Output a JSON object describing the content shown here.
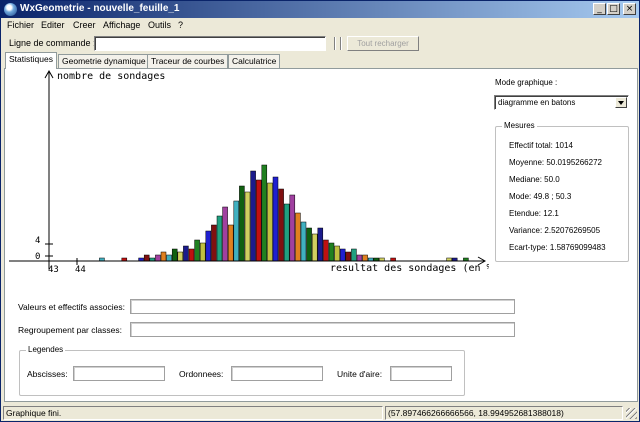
{
  "window": {
    "title": "WxGeometrie - nouvelle_feuille_1",
    "controls": [
      "_",
      "□",
      "×"
    ]
  },
  "menu": [
    "Fichier",
    "Editer",
    "Creer",
    "Affichage",
    "Outils",
    "?"
  ],
  "toolbar": {
    "command_label": "Ligne de commande :",
    "command_value": "",
    "reload_label": "Tout recharger"
  },
  "tabs": [
    "Statistiques",
    "Geometrie dynamique",
    "Traceur de courbes",
    "Calculatrice"
  ],
  "active_tab": 0,
  "chart_data": {
    "type": "bar",
    "ylabel": "nombre de sondages",
    "xlabel": "resultat des sondages (en %)",
    "x_tick_labels": [
      "43",
      "44"
    ],
    "y_tick_labels": [
      "0",
      "4"
    ],
    "x_values": [
      43.0,
      43.2,
      43.4,
      43.6,
      43.8,
      44.0,
      44.2,
      44.4,
      44.6,
      44.8,
      45.0,
      45.2,
      45.4,
      45.6,
      45.8,
      46.0,
      46.2,
      46.4,
      46.6,
      46.8,
      47.0,
      47.2,
      47.4,
      47.6,
      47.8,
      48.0,
      48.2,
      48.4,
      48.6,
      48.8,
      49.0,
      49.2,
      49.4,
      49.6,
      49.8,
      50.0,
      50.2,
      50.4,
      50.6,
      50.8,
      51.0,
      51.2,
      51.4,
      51.6,
      51.8,
      52.0,
      52.2,
      52.4,
      52.6,
      52.8,
      53.0,
      53.2,
      53.4,
      53.6,
      53.8,
      54.0,
      54.2,
      54.4,
      54.6,
      54.8,
      55.0,
      55.2,
      55.4,
      55.6,
      55.8,
      56.0,
      56.2,
      56.4,
      56.6,
      56.8,
      57.0,
      57.2,
      57.4,
      57.6,
      57.8
    ],
    "y_values": [
      0,
      0,
      0,
      0,
      0,
      0,
      0,
      0,
      0,
      1,
      0,
      0,
      0,
      1,
      0,
      0,
      1,
      2,
      1,
      2,
      3,
      2,
      4,
      3,
      5,
      4,
      7,
      6,
      10,
      12,
      15,
      18,
      12,
      20,
      25,
      23,
      30,
      27,
      32,
      26,
      28,
      24,
      19,
      22,
      16,
      13,
      11,
      9,
      11,
      7,
      6,
      5,
      4,
      3,
      4,
      2,
      2,
      1,
      1,
      1,
      0,
      1,
      0,
      0,
      0,
      0,
      0,
      0,
      0,
      0,
      0,
      1,
      1,
      0,
      1
    ],
    "colors": [
      "#1b1b8c",
      "#c01010",
      "#208020",
      "#c0c040",
      "#2020d0",
      "#801010",
      "#20a080",
      "#a040a0",
      "#e08020",
      "#40b0c0",
      "#106010",
      "#d0d060"
    ]
  },
  "mode": {
    "label": "Mode graphique :",
    "value": "diagramme en batons"
  },
  "mesures": {
    "title": "Mesures",
    "items": [
      "Effectif total: 1014",
      "Moyenne: 50.0195266272",
      "Mediane: 50.0",
      "Mode: 49.8 ; 50.3",
      "Etendue: 12.1",
      "Variance: 2.52076269505",
      "Ecart-type: 1.58769099483"
    ]
  },
  "fields": {
    "valeurs_label": "Valeurs et effectifs associes:",
    "valeurs_value": "",
    "regroupement_label": "Regroupement par classes:",
    "regroupement_value": ""
  },
  "legendes": {
    "title": "Legendes",
    "abscisses_label": "Abscisses:",
    "ordonnees_label": "Ordonnees:",
    "unite_label": "Unite d'aire:",
    "abscisses_value": "",
    "ordonnees_value": "",
    "unite_value": ""
  },
  "status": {
    "message": "Graphique fini.",
    "coords": "(57.897466266666566, 18.994952681388018)"
  }
}
